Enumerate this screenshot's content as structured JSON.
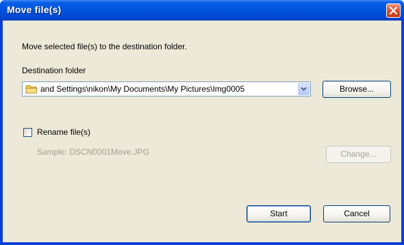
{
  "window": {
    "title": "Move file(s)"
  },
  "instruction": "Move selected file(s) to the destination folder.",
  "destination": {
    "label": "Destination folder",
    "path": "and Settings\\nikon\\My Documents\\My Pictures\\Img0005",
    "browse_label": "Browse..."
  },
  "rename": {
    "label": "Rename file(s)",
    "checked": false,
    "sample": "Sample: DSCN0001Move.JPG",
    "change_label": "Change..."
  },
  "buttons": {
    "start": "Start",
    "cancel": "Cancel"
  },
  "colors": {
    "titlebar": "#0054e3",
    "client": "#ece9d8",
    "close": "#e0502a"
  }
}
